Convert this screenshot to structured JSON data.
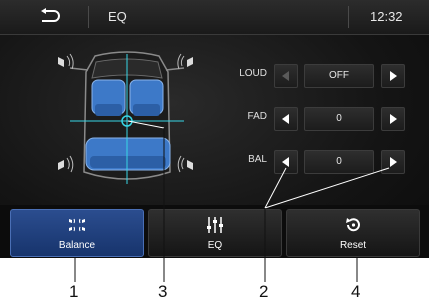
{
  "header": {
    "title": "EQ",
    "clock": "12:32"
  },
  "controls": [
    {
      "label": "LOUD",
      "value": "OFF",
      "left_enabled": false
    },
    {
      "label": "FAD",
      "value": "0",
      "left_enabled": true
    },
    {
      "label": "BAL",
      "value": "0",
      "left_enabled": true
    }
  ],
  "tabs": [
    {
      "label": "Balance",
      "icon": "speakers-icon",
      "active": true
    },
    {
      "label": "EQ",
      "icon": "sliders-icon",
      "active": false
    },
    {
      "label": "Reset",
      "icon": "reset-icon",
      "active": false
    }
  ],
  "callouts": [
    "1",
    "3",
    "2",
    "4"
  ],
  "colors": {
    "active_tab": "#23458a",
    "seat_blue": "#3d79c8",
    "crosshair": "#37d6e6"
  }
}
